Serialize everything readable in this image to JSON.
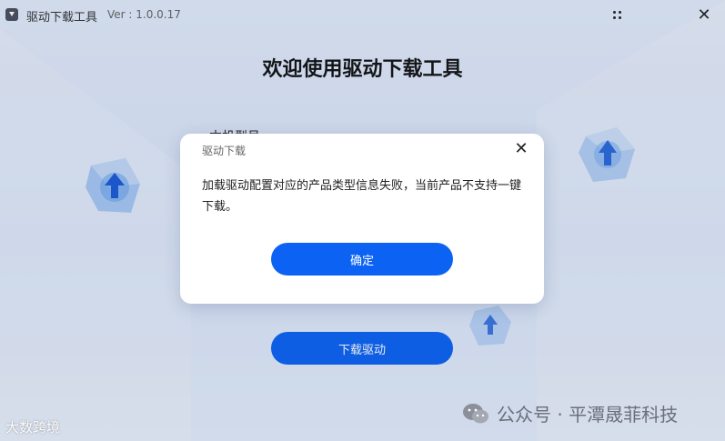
{
  "window": {
    "app_title": "驱动下载工具",
    "version": "Ver : 1.0.0.17",
    "title_icon": "download-app-icon",
    "menu_icon": "grid-dots-icon",
    "close_icon": "close-icon",
    "close_glyph": "✕"
  },
  "main": {
    "heading": "欢迎使用驱动下载工具",
    "partial_label": "本机型号",
    "download_button": "下载驱动"
  },
  "dialog": {
    "title": "驱动下载",
    "close_glyph": "✕",
    "message": "加载驱动配置对应的产品类型信息失败，当前产品不支持一键下载。",
    "confirm_button": "确定"
  },
  "watermarks": {
    "left": "大数跨境",
    "right": "公众号 · 平潭晟菲科技"
  },
  "colors": {
    "accent": "#0c63f3",
    "background": "#dde7fa",
    "dialog_bg": "#ffffff"
  }
}
